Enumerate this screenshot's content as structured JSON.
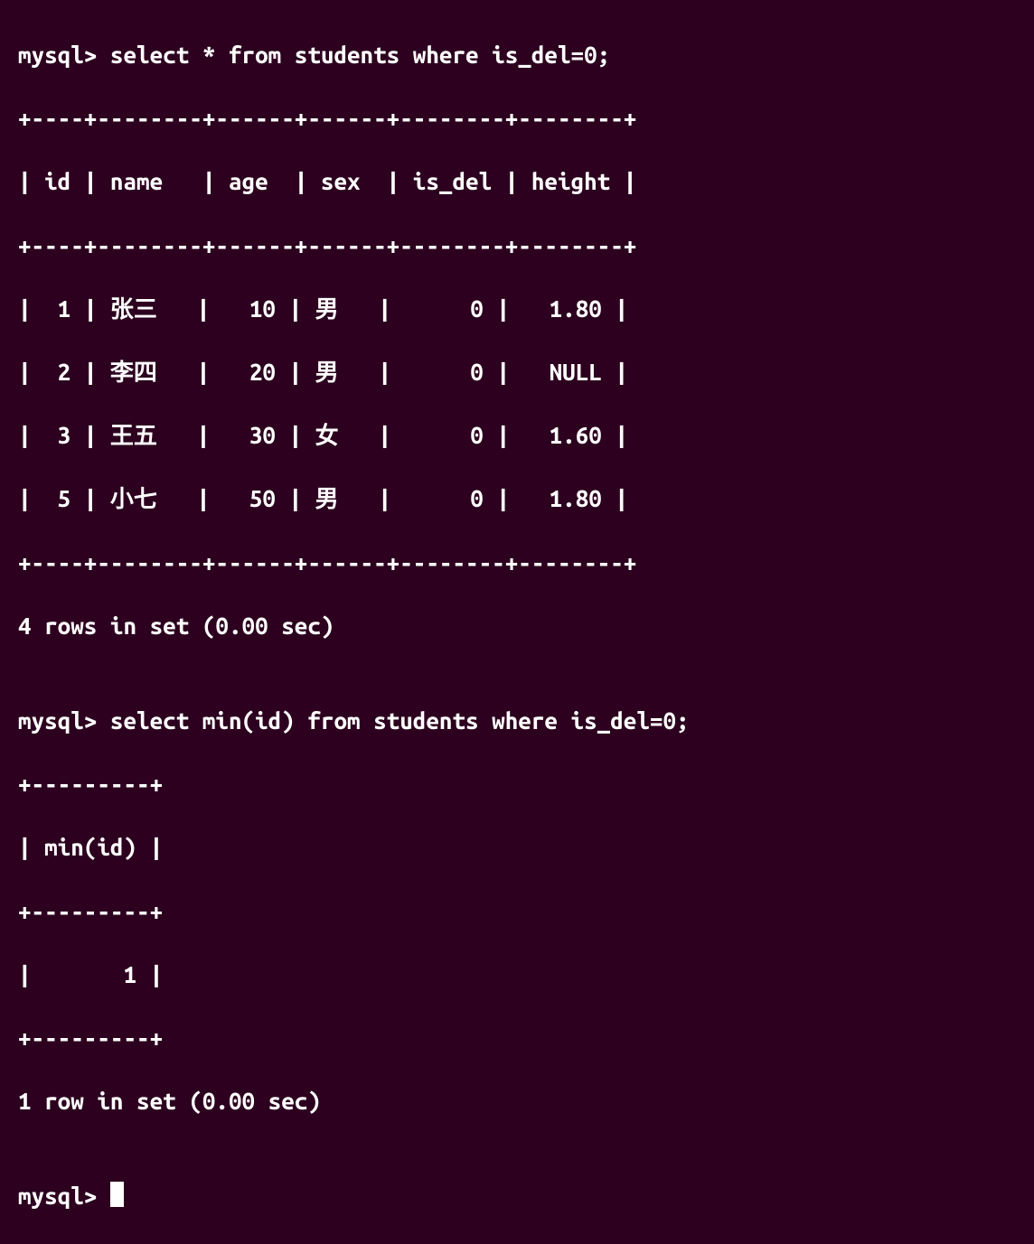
{
  "prompt": "mysql> ",
  "query1": {
    "line": "select * from students where is_del=0;",
    "border1": "+----+--------+------+------+--------+--------+",
    "header": "| id | name   | age  | sex  | is_del | height |",
    "border2": "+----+--------+------+------+--------+--------+",
    "rows": [
      "|  1 | 张三   |   10 | 男   |      0 |   1.80 |",
      "|  2 | 李四   |   20 | 男   |      0 |   NULL |",
      "|  3 | 王五   |   30 | 女   |      0 |   1.60 |",
      "|  5 | 小七   |   50 | 男   |      0 |   1.80 |"
    ],
    "border3": "+----+--------+------+------+--------+--------+",
    "status": "4 rows in set (0.00 sec)"
  },
  "blank": "",
  "query2": {
    "line": "select min(id) from students where is_del=0;",
    "border1": "+---------+",
    "header": "| min(id) |",
    "border2": "+---------+",
    "rows": [
      "|       1 |"
    ],
    "border3": "+---------+",
    "status": "1 row in set (0.00 sec)"
  }
}
